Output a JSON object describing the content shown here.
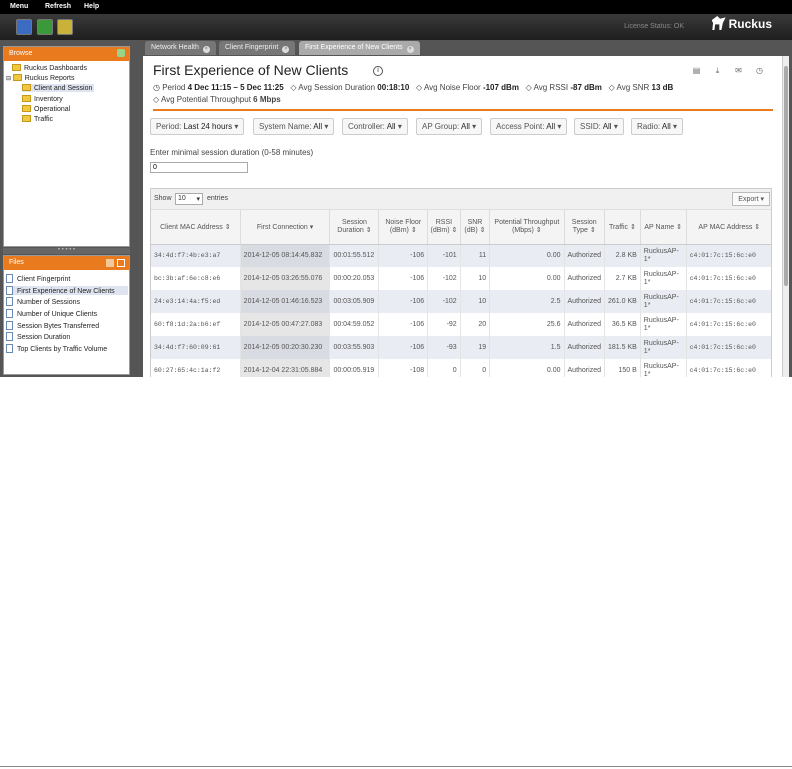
{
  "menubar": {
    "menu": "Menu",
    "refresh": "Refresh",
    "help": "Help"
  },
  "toolbar": {
    "license_status": "License Status: OK",
    "brand": "Ruckus"
  },
  "browse": {
    "title": "Browse",
    "items": [
      {
        "label": "Ruckus Dashboards"
      },
      {
        "label": "Ruckus Reports"
      },
      {
        "label": "Client and Session"
      },
      {
        "label": "Inventory"
      },
      {
        "label": "Operational"
      },
      {
        "label": "Traffic"
      }
    ]
  },
  "files": {
    "title": "Files",
    "items": [
      {
        "label": "Client Fingerprint"
      },
      {
        "label": "First Experience of New Clients"
      },
      {
        "label": "Number of Sessions"
      },
      {
        "label": "Number of Unique Clients"
      },
      {
        "label": "Session Bytes Transferred"
      },
      {
        "label": "Session Duration"
      },
      {
        "label": "Top Clients by Traffic Volume"
      }
    ]
  },
  "tabs": [
    {
      "label": "Network Health"
    },
    {
      "label": "Client Fingerprint"
    },
    {
      "label": "First Experience of New Clients"
    }
  ],
  "report": {
    "title": "First Experience of New Clients",
    "period_label": "Period",
    "period_value": "4 Dec 11:15 – 5 Dec 11:25",
    "avg_session_label": "Avg Session Duration",
    "avg_session_value": "00:18:10",
    "avg_noise_label": "Avg Noise Floor",
    "avg_noise_value": "-107 dBm",
    "avg_rssi_label": "Avg RSSI",
    "avg_rssi_value": "-87 dBm",
    "avg_snr_label": "Avg SNR",
    "avg_snr_value": "13 dB",
    "avg_tp_label": "Avg Potential Throughput",
    "avg_tp_value": "6 Mbps"
  },
  "filters": [
    {
      "label": "Period:",
      "value": "Last 24 hours"
    },
    {
      "label": "System Name:",
      "value": "All"
    },
    {
      "label": "Controller:",
      "value": "All"
    },
    {
      "label": "AP Group:",
      "value": "All"
    },
    {
      "label": "Access Point:",
      "value": "All"
    },
    {
      "label": "SSID:",
      "value": "All"
    },
    {
      "label": "Radio:",
      "value": "All"
    }
  ],
  "duration_filter": {
    "label": "Enter minimal session duration (0-58 minutes)",
    "value": "0"
  },
  "grid": {
    "show_label": "Show",
    "page_size": "10",
    "entries_label": "entries",
    "export_label": "Export",
    "columns": [
      "Client MAC Address",
      "First Connection",
      "Session Duration",
      "Noise Floor (dBm)",
      "RSSI (dBm)",
      "SNR (dB)",
      "Potential Throughput (Mbps)",
      "Session Type",
      "Traffic",
      "AP Name",
      "AP MAC Address"
    ],
    "rows": [
      [
        "34:4d:f7:4b:e3:a7",
        "2014-12-05 08:14:45.832",
        "00:01:55.512",
        "-106",
        "-101",
        "11",
        "0.00",
        "Authorized",
        "2.8 KB",
        "RuckusAP-1*",
        "c4:01:7c:15:6c:e0"
      ],
      [
        "bc:3b:af:6e:c8:e6",
        "2014-12-05 03:26:55.076",
        "00:00:20.053",
        "-106",
        "-102",
        "10",
        "0.00",
        "Authorized",
        "2.7 KB",
        "RuckusAP-1*",
        "c4:01:7c:15:6c:e0"
      ],
      [
        "24:e3:14:4a:f5:ed",
        "2014-12-05 01:46:16.523",
        "00:03:05.909",
        "-106",
        "-102",
        "10",
        "2.5",
        "Authorized",
        "261.0 KB",
        "RuckusAP-1*",
        "c4:01:7c:15:6c:e0"
      ],
      [
        "60:f8:1d:2a:b6:ef",
        "2014-12-05 00:47:27.083",
        "00:04:59.052",
        "-106",
        "-92",
        "20",
        "25.6",
        "Authorized",
        "36.5 KB",
        "RuckusAP-1*",
        "c4:01:7c:15:6c:e0"
      ],
      [
        "34:4d:f7:60:09:61",
        "2014-12-05 00:20:30.230",
        "00:03:55.903",
        "-106",
        "-93",
        "19",
        "1.5",
        "Authorized",
        "181.5 KB",
        "RuckusAP-1*",
        "c4:01:7c:15:6c:e0"
      ],
      [
        "60:27:65:4c:1a:f2",
        "2014-12-04 22:31:05.884",
        "00:00:05.919",
        "-108",
        "0",
        "0",
        "0.00",
        "Authorized",
        "150 B",
        "RuckusAP-1*",
        "c4:01:7c:15:6c:e0"
      ]
    ]
  }
}
